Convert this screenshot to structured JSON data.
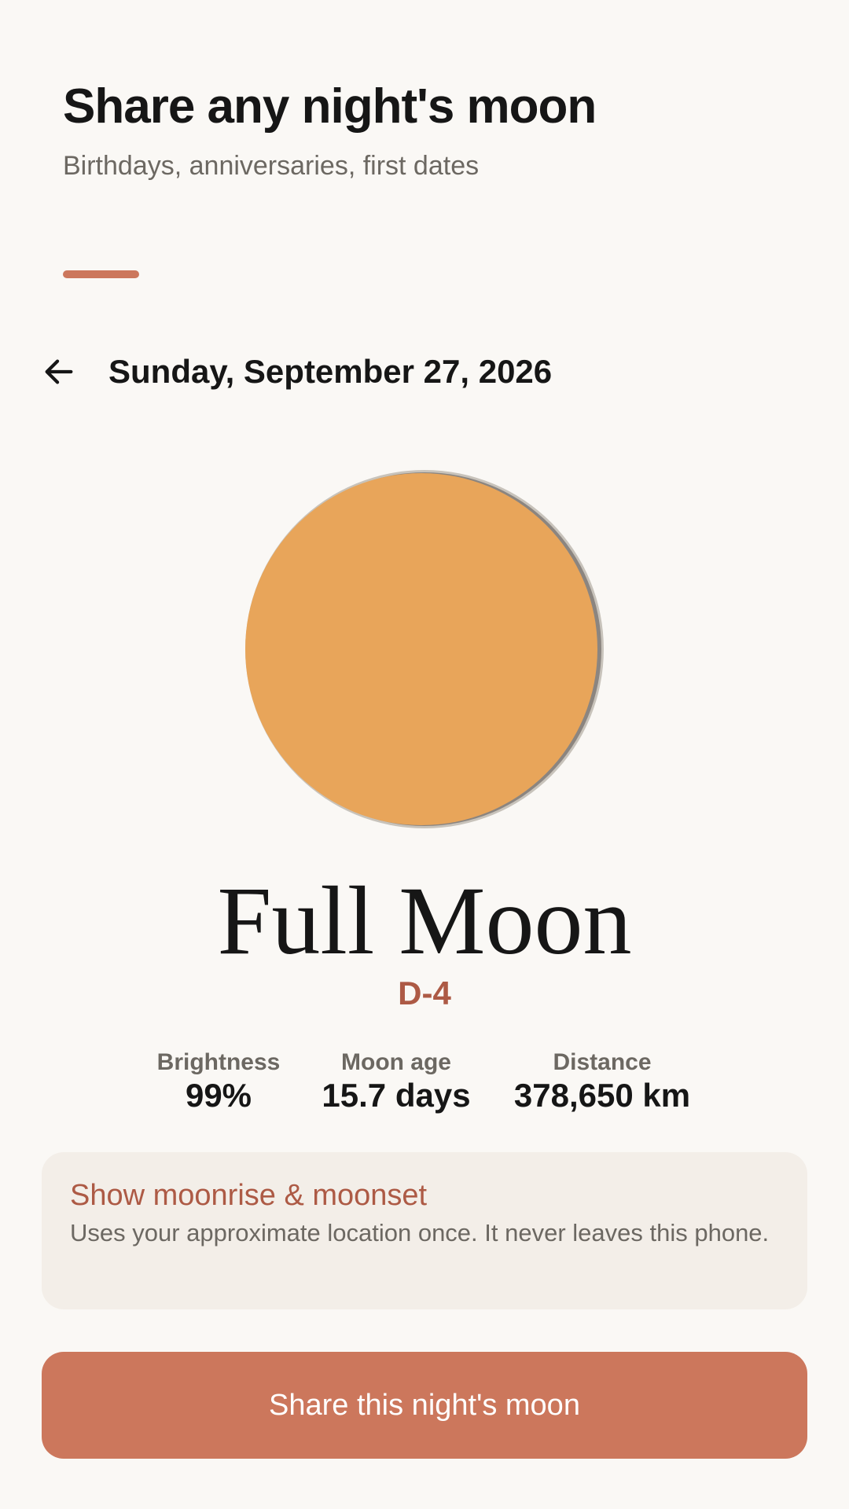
{
  "header": {
    "title": "Share any night's moon",
    "subtitle": "Birthdays, anniversaries, first dates"
  },
  "date_nav": {
    "back_icon": "arrow-left-icon",
    "date": "Sunday, September 27, 2026"
  },
  "moon": {
    "phase": "Full Moon",
    "countdown": "D-4",
    "illumination": 0.99,
    "color": "#e8a55a",
    "outline_color": "#c8c3bb"
  },
  "stats": [
    {
      "label": "Brightness",
      "value": "99%"
    },
    {
      "label": "Moon age",
      "value": "15.7 days"
    },
    {
      "label": "Distance",
      "value": "378,650 km"
    }
  ],
  "location_card": {
    "title": "Show moonrise & moonset",
    "description": "Uses your approximate location once. It never leaves this phone."
  },
  "share_button": {
    "label": "Share this night's moon"
  },
  "colors": {
    "accent": "#cc775c",
    "accent_text": "#ad5a45",
    "background": "#faf8f5",
    "card": "#f3eee8"
  }
}
